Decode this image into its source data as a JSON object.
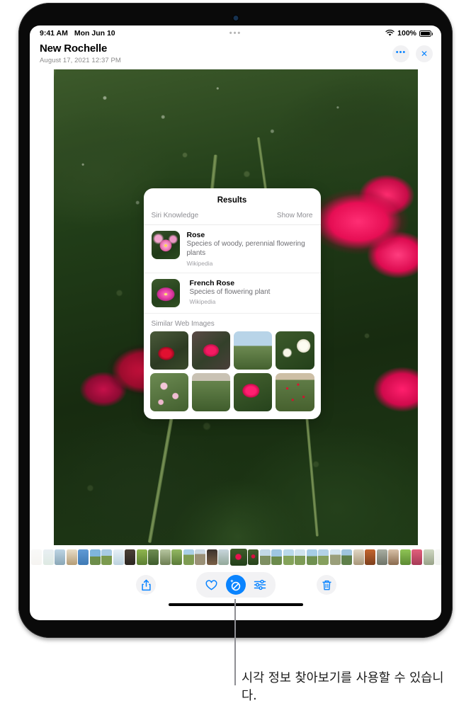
{
  "status_bar": {
    "time": "9:41 AM",
    "date": "Mon Jun 10",
    "multitask_handle": "•••",
    "wifi_icon": "wifi-icon",
    "battery_percent": "100%",
    "battery_icon": "battery-full-icon"
  },
  "header": {
    "title": "New Rochelle",
    "subtitle": "August 17, 2021  12:37 PM",
    "more_button": "•••",
    "close_button": "✕"
  },
  "results_panel": {
    "title": "Results",
    "section_label": "Siri Knowledge",
    "show_more": "Show More",
    "entries": [
      {
        "name": "Rose",
        "description": "Species of woody, perennial flowering plants",
        "source": "Wikipedia",
        "thumb": "pink-rose-thumbnail"
      },
      {
        "name": "French Rose",
        "description": "Species of flowering plant",
        "source": "Wikipedia",
        "thumb": "magenta-rose-thumbnail"
      }
    ],
    "similar_label": "Similar Web Images",
    "similar_images": [
      "red-rose-closeup",
      "magenta-rose-bush",
      "rose-garden-with-sky",
      "white-roses",
      "pale-pink-roses",
      "green-rose-shrub",
      "magenta-rose-buds",
      "red-rose-shrub-with-label"
    ]
  },
  "toolbar": {
    "share": "share-icon",
    "favorite": "heart-icon",
    "visual_lookup": "visual-lookup-icon",
    "adjust": "adjustments-icon",
    "delete": "trash-icon"
  },
  "callout": {
    "text": "시각 정보 찾아보기를 사용할 수 있습니다."
  },
  "colors": {
    "accent": "#0a84ff",
    "secondary_text": "#8e8e93",
    "panel_bg": "#ffffff",
    "control_bg": "#f2f2f4"
  }
}
